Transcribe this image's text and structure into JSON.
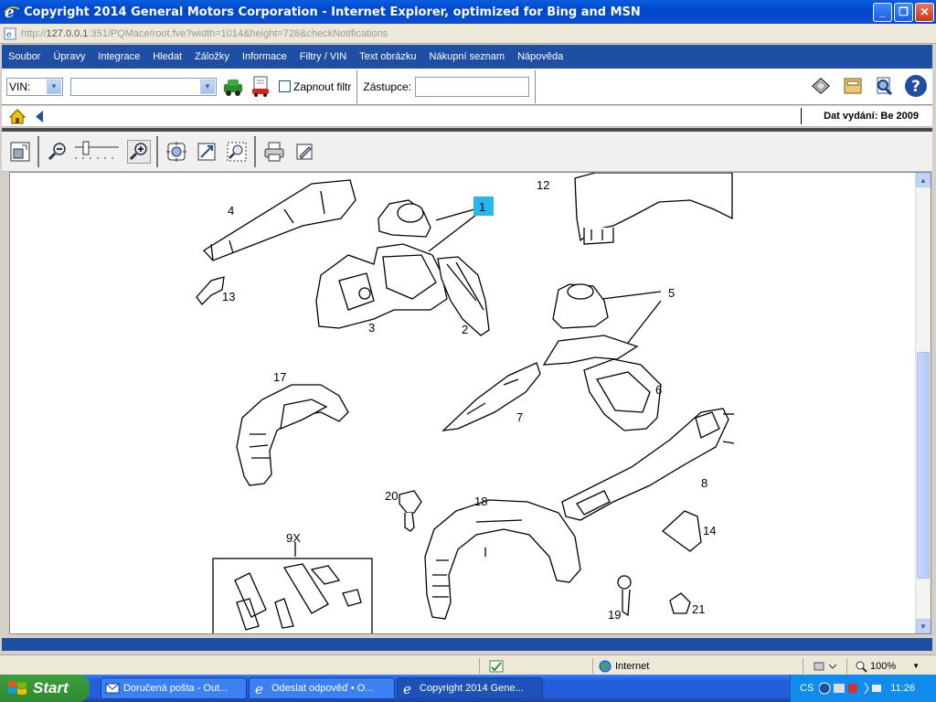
{
  "window": {
    "title": "Copyright 2014 General Motors Corporation - Internet Explorer, optimized for Bing and MSN",
    "url_prefix": "http://",
    "url_host": "127.0.0.1",
    "url_rest": ":351/PQMace/root.fve?width=1014&height=728&checkNotifications"
  },
  "menu": {
    "items": [
      "Soubor",
      "Úpravy",
      "Integrace",
      "Hledat",
      "Záložky",
      "Informace",
      "Filtry / VIN",
      "Text obrázku",
      "Nákupní seznam",
      "Nápověda"
    ]
  },
  "toolbar": {
    "vin_label": "VIN:",
    "filter_label": "Zapnout filtr",
    "dealer_label": "Zástupce:",
    "dealer_value": ""
  },
  "navbar": {
    "release_date": "Dat vydání: Be 2009"
  },
  "diagram": {
    "labels": [
      "1",
      "2",
      "3",
      "4",
      "5",
      "6",
      "7",
      "8",
      "9X",
      "12",
      "13",
      "14",
      "17",
      "18",
      "19",
      "20",
      "21"
    ],
    "highlighted_label": "1",
    "highlight_color": "#29b6e8"
  },
  "status": {
    "zone": "Internet",
    "zoom": "100%"
  },
  "taskbar": {
    "start_label": "Start",
    "tasks": [
      "Doručená pošta - Out...",
      "Odeslat odpověď • O...",
      "Copyright 2014 Gene..."
    ],
    "language": "CS",
    "clock": "11:26"
  },
  "colors": {
    "menu_bg": "#1f4fa3",
    "title_bg": "#0046c8"
  }
}
